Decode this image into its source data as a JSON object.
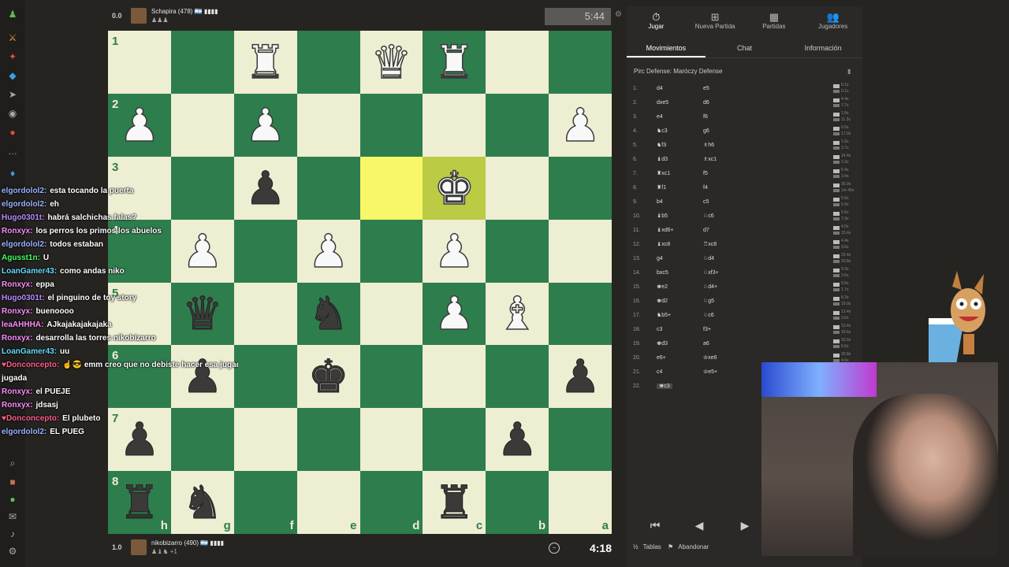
{
  "top_player": {
    "score": "0.0",
    "name": "Schapira (478) 🇦🇷 ▮▮▮▮",
    "captured": "♟♟♟"
  },
  "bottom_player": {
    "score": "1.0",
    "name": "nikobizarro (490) 🇦🇷 ▮▮▮▮",
    "captured": "♟♝♞ +1"
  },
  "clocks": {
    "top": "5:44",
    "bottom": "4:18"
  },
  "board": {
    "ranks": [
      "1",
      "2",
      "3",
      "4",
      "5",
      "6",
      "7",
      "8"
    ],
    "files": [
      "h",
      "g",
      "f",
      "e",
      "d",
      "c",
      "b",
      "a"
    ],
    "rows": [
      [
        "",
        "",
        "wR",
        "",
        "wQ",
        "wR",
        "",
        ""
      ],
      [
        "wP",
        "",
        "wP",
        "",
        "",
        "",
        "",
        "wP"
      ],
      [
        "",
        "",
        "bP",
        "",
        "",
        "wK",
        "",
        ""
      ],
      [
        "",
        "wP",
        "",
        "wP",
        "",
        "wP",
        "",
        ""
      ],
      [
        "",
        "bQ",
        "",
        "bN",
        "",
        "wP",
        "wB",
        ""
      ],
      [
        "",
        "bP",
        "",
        "bK",
        "",
        "",
        "",
        "bP"
      ],
      [
        "bP",
        "",
        "",
        "",
        "",
        "",
        "bP",
        ""
      ],
      [
        "bR",
        "bN",
        "",
        "",
        "",
        "bR",
        "",
        ""
      ]
    ],
    "highlight": [
      [
        2,
        4
      ],
      [
        2,
        5
      ]
    ]
  },
  "chat": [
    {
      "user": "elgordolol2:",
      "color": "#9bb3ff",
      "msg": "esta tocando la puerta"
    },
    {
      "user": "elgordolol2:",
      "color": "#9bb3ff",
      "msg": "eh"
    },
    {
      "user": "Hugo0301t:",
      "color": "#b88cff",
      "msg": "habrá salchichas falas?"
    },
    {
      "user": "Ronxyx:",
      "color": "#ff8cff",
      "msg": "los perros los primos los abuelos"
    },
    {
      "user": "elgordolol2:",
      "color": "#9bb3ff",
      "msg": "todos estaban"
    },
    {
      "user": "Agusst1n:",
      "color": "#44ff66",
      "msg": "U"
    },
    {
      "user": "LoanGamer43:",
      "color": "#66d9ff",
      "msg": "como andas niko"
    },
    {
      "user": "Ronxyx:",
      "color": "#ff8cff",
      "msg": "eppa"
    },
    {
      "user": "Hugo0301t:",
      "color": "#b88cff",
      "msg": "el pinguino de toy story"
    },
    {
      "user": "Ronxyx:",
      "color": "#ff8cff",
      "msg": "buenoooo"
    },
    {
      "user": "leaAHHHA:",
      "color": "#ff8cff",
      "msg": "AJkajakajakajaka"
    },
    {
      "user": "Ronxyx:",
      "color": "#ff8cff",
      "msg": "desarrolla las torres nikobizarro"
    },
    {
      "user": "LoanGamer43:",
      "color": "#66d9ff",
      "msg": "uu"
    },
    {
      "user": "♥Donconcepto:",
      "color": "#ff5c8a",
      "msg": "☝😎 emm creo que no debiste hacer esa jugada"
    },
    {
      "user": "",
      "color": "#ffffff",
      "msg": "jugada"
    },
    {
      "user": "Ronxyx:",
      "color": "#ff8cff",
      "msg": "el PUEJE"
    },
    {
      "user": "Ronxyx:",
      "color": "#ff8cff",
      "msg": "jdsasj"
    },
    {
      "user": "♥Donconcepto:",
      "color": "#ff5c8a",
      "msg": "El plubeto"
    },
    {
      "user": "elgordolol2:",
      "color": "#9bb3ff",
      "msg": "EL PUEG"
    }
  ],
  "panel": {
    "top_tabs": [
      {
        "icon": "⏱",
        "label": "Jugar"
      },
      {
        "icon": "⊞",
        "label": "Nueva Partida"
      },
      {
        "icon": "▦",
        "label": "Partidas"
      },
      {
        "icon": "👥",
        "label": "Jugadores"
      }
    ],
    "sub_tabs": [
      "Movimientos",
      "Chat",
      "Información"
    ],
    "opening": "Pirc Defense: Maróczy Defense",
    "moves": [
      {
        "n": "1.",
        "w": "d4",
        "b": "e5",
        "t1": "0.1s",
        "t2": "0.1s"
      },
      {
        "n": "2.",
        "w": "dxe5",
        "b": "d6",
        "t1": "4.4s",
        "t2": "7.7s"
      },
      {
        "n": "3.",
        "w": "e4",
        "b": "f6",
        "t1": "1.8s",
        "t2": "11.3s"
      },
      {
        "n": "4.",
        "w": "♞c3",
        "b": "g6",
        "t1": "6.0s",
        "t2": "17.9s"
      },
      {
        "n": "5.",
        "w": "♞f3",
        "b": "♗h6",
        "t1": "1.5s",
        "t2": "3.7s"
      },
      {
        "n": "6.",
        "w": "♝d3",
        "b": "♗xc1",
        "t1": "14.4s",
        "t2": "2.3s"
      },
      {
        "n": "7.",
        "w": "♜xc1",
        "b": "f5",
        "t1": "5.4s",
        "t2": "3.4s"
      },
      {
        "n": "8.",
        "w": "♜f1",
        "b": "f4",
        "t1": "35.9s",
        "t2": "1m 45s"
      },
      {
        "n": "9.",
        "w": "b4",
        "b": "c5",
        "t1": "5.6s",
        "t2": "5.9s"
      },
      {
        "n": "10.",
        "w": "♝b5",
        "b": "♘c6",
        "t1": "5.6s",
        "t2": "7.3s"
      },
      {
        "n": "11.",
        "w": "♝xd6+",
        "b": "d7",
        "t1": "4.0s",
        "t2": "15.4s"
      },
      {
        "n": "12.",
        "w": "♝xc8",
        "b": "♖xc8",
        "t1": "4.4s",
        "t2": "3.6s"
      },
      {
        "n": "13.",
        "w": "g4",
        "b": "♘d4",
        "t1": "22.4s",
        "t2": "20.8s"
      },
      {
        "n": "14.",
        "w": "bxc5",
        "b": "♘xf3+",
        "t1": "9.3s",
        "t2": "3.6s"
      },
      {
        "n": "15.",
        "w": "♚e2",
        "b": "♘d4+",
        "t1": "9.5s",
        "t2": "1.7s"
      },
      {
        "n": "16.",
        "w": "♚d2",
        "b": "♘g5",
        "t1": "8.2s",
        "t2": "19.0s"
      },
      {
        "n": "17.",
        "w": "♞b5+",
        "b": "♘c6",
        "t1": "13.4s",
        "t2": "3.6s"
      },
      {
        "n": "18.",
        "w": "c3",
        "b": "f3+",
        "t1": "13.4s",
        "t2": "18.6s"
      },
      {
        "n": "19.",
        "w": "♚d3",
        "b": "a6",
        "t1": "32.6s",
        "t2": "6.0s"
      },
      {
        "n": "20.",
        "w": "e6+",
        "b": "♔xe6",
        "t1": "20.8s",
        "t2": "4.6s"
      },
      {
        "n": "21.",
        "w": "c4",
        "b": "♔e5+",
        "t1": "13.5s",
        "t2": "1.4s"
      },
      {
        "n": "22.",
        "w": "♚c3",
        "b": "",
        "t1": "",
        "t2": ""
      }
    ],
    "footer": {
      "tables": "Tablas",
      "resign": "Abandonar"
    }
  }
}
